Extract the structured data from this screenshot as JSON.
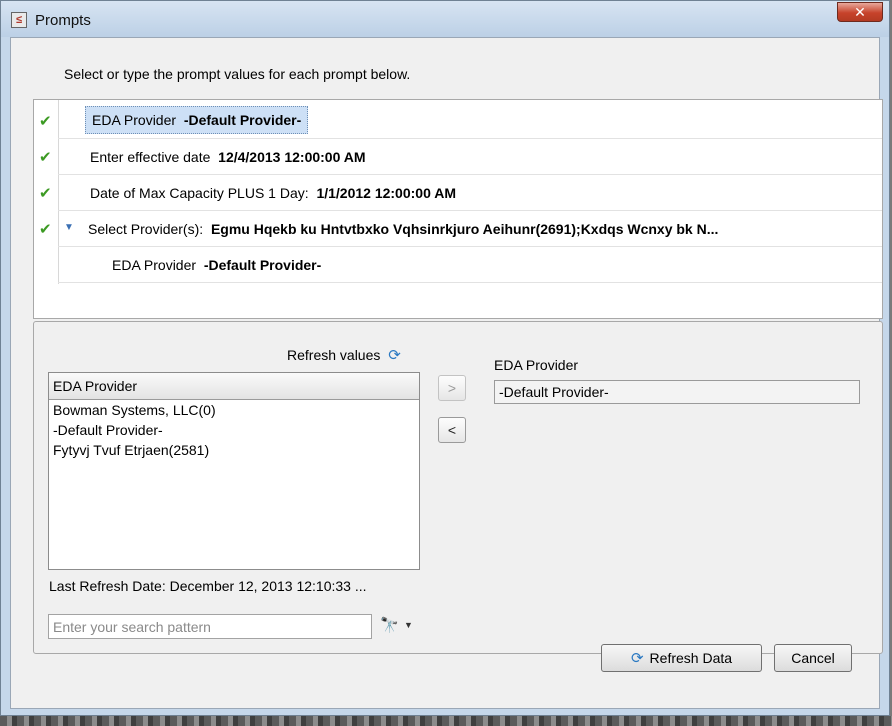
{
  "window": {
    "title": "Prompts",
    "app_icon_glyph": "≤",
    "close_glyph": "✕"
  },
  "instruction": "Select or type the prompt values for each prompt below.",
  "prompts": [
    {
      "label": "EDA Provider",
      "value": "-Default Provider-",
      "status": "done",
      "selected": true
    },
    {
      "label": "Enter effective date",
      "value": "12/4/2013 12:00:00 AM",
      "status": "done"
    },
    {
      "label": "Date of Max Capacity PLUS 1 Day:",
      "value": "1/1/2012 12:00:00 AM",
      "status": "done"
    },
    {
      "label": "Select Provider(s):",
      "value": "Egmu Hqekb ku Hntvtbxko Vqhsinrkjuro Aeihunr(2691);Kxdqs Wcnxy bk N...",
      "status": "done",
      "expanded": true
    },
    {
      "label": "EDA Provider",
      "value": "-Default Provider-",
      "child": true
    }
  ],
  "icons": {
    "check": "✔",
    "expand_arrow": "▼",
    "refresh": "⟳",
    "binoculars": "🔭",
    "caret": "▼",
    "move_right": ">",
    "move_left": "<"
  },
  "lov": {
    "refresh_values_label": "Refresh values",
    "column_header": "EDA Provider",
    "items": [
      "Bowman Systems, LLC(0)",
      "-Default Provider-",
      "Fytyvj Tvuf Etrjaen(2581)"
    ],
    "last_refresh": "Last Refresh Date: December 12, 2013 12:10:33 ...",
    "search_placeholder": "Enter your search pattern"
  },
  "selection": {
    "label": "EDA Provider",
    "value": "-Default Provider-"
  },
  "buttons": {
    "refresh_data": "Refresh Data",
    "cancel": "Cancel"
  },
  "colors": {
    "check_green": "#3c9a23",
    "selection_blue": "#cde0f6",
    "close_red": "#c7432b"
  }
}
